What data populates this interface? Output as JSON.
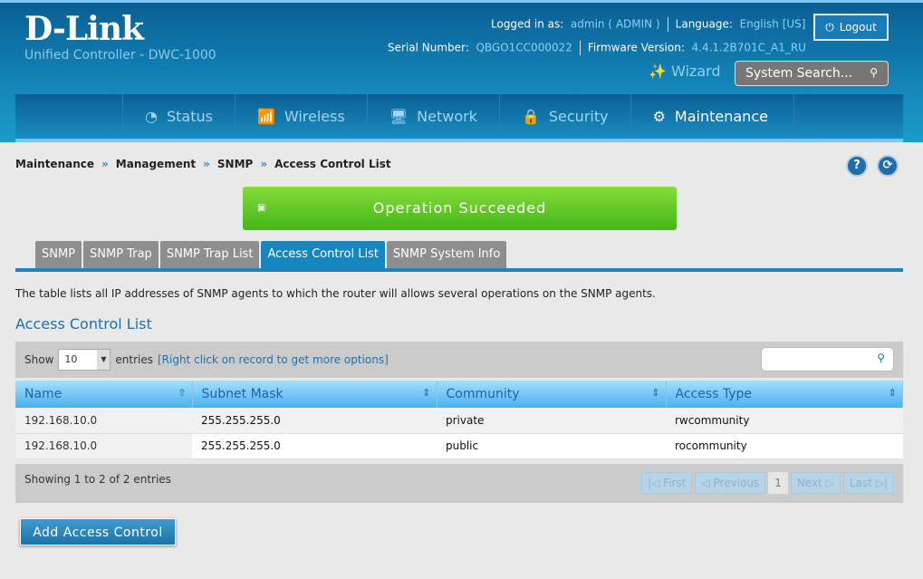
{
  "header": {
    "brand": "D-Link",
    "subtitle": "Unified Controller - DWC-1000",
    "logged_label": "Logged in as:",
    "user": "admin ( ADMIN )",
    "language_label": "Language:",
    "language": "English [US]",
    "logout": "Logout",
    "serial_label": "Serial Number:",
    "serial": "QBGO1CC000022",
    "firmware_label": "Firmware Version:",
    "firmware": "4.4.1.2B701C_A1_RU",
    "wizard": "Wizard",
    "search_placeholder": "System Search..."
  },
  "nav": [
    "Status",
    "Wireless",
    "Network",
    "Security",
    "Maintenance"
  ],
  "breadcrumb": [
    "Maintenance",
    "Management",
    "SNMP",
    "Access Control List"
  ],
  "banner": "Operation Succeeded",
  "tabs": [
    "SNMP",
    "SNMP Trap",
    "SNMP Trap List",
    "Access Control List",
    "SNMP System Info"
  ],
  "description": "The table lists all IP addresses of SNMP agents to which the router will allows several operations on the SNMP agents.",
  "title": "Access Control List",
  "toolbar": {
    "show": "Show",
    "entries_value": "10",
    "entries": "entries",
    "hint": "[Right click on record to get more options]"
  },
  "columns": [
    "Name",
    "Subnet Mask",
    "Community",
    "Access Type"
  ],
  "rows": [
    [
      "192.168.10.0",
      "255.255.255.0",
      "private",
      "rwcommunity"
    ],
    [
      "192.168.10.0",
      "255.255.255.0",
      "public",
      "rocommunity"
    ]
  ],
  "footer": {
    "count": "Showing 1 to 2 of 2 entries",
    "first": "First",
    "previous": "Previous",
    "page": "1",
    "next": "Next",
    "last": "Last"
  },
  "add_button": "Add Access Control"
}
